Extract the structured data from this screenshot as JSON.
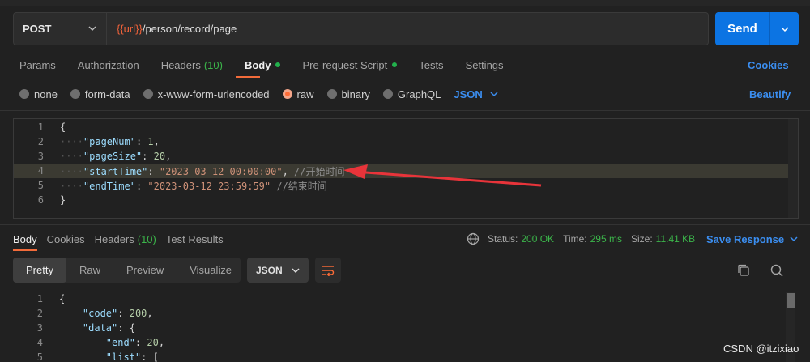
{
  "request": {
    "method": "POST",
    "url_var": "{{url}}",
    "url_path": "/person/record/page",
    "send_label": "Send"
  },
  "tabs": [
    {
      "label": "Params"
    },
    {
      "label": "Authorization"
    },
    {
      "label": "Headers",
      "count": "(10)"
    },
    {
      "label": "Body"
    },
    {
      "label": "Pre-request Script"
    },
    {
      "label": "Tests"
    },
    {
      "label": "Settings"
    }
  ],
  "cookies_label": "Cookies",
  "body_types": [
    "none",
    "form-data",
    "x-www-form-urlencoded",
    "raw",
    "binary",
    "GraphQL"
  ],
  "body_format": "JSON",
  "beautify_label": "Beautify",
  "request_body": {
    "line_numbers": [
      "1",
      "2",
      "3",
      "4",
      "5",
      "6"
    ],
    "l1": "{",
    "l2_key": "\"pageNum\"",
    "l2_val": "1",
    "l3_key": "\"pageSize\"",
    "l3_val": "20",
    "l4_key": "\"startTime\"",
    "l4_val": "\"2023-03-12 00:00:00\"",
    "l4_comment": "//开始时间",
    "l5_key": "\"endTime\"",
    "l5_val": "\"2023-03-12 23:59:59\"",
    "l5_comment": "//结束时间",
    "l6": "}"
  },
  "response": {
    "tabs": [
      {
        "label": "Body"
      },
      {
        "label": "Cookies"
      },
      {
        "label": "Headers",
        "count": "(10)"
      },
      {
        "label": "Test Results"
      }
    ],
    "status_label": "Status:",
    "status_value": "200 OK",
    "time_label": "Time:",
    "time_value": "295 ms",
    "size_label": "Size:",
    "size_value": "11.41 KB",
    "save_label": "Save Response",
    "views": [
      "Pretty",
      "Raw",
      "Preview",
      "Visualize"
    ],
    "format": "JSON",
    "line_numbers": [
      "1",
      "2",
      "3",
      "4",
      "5"
    ],
    "l1": "{",
    "l2_key": "\"code\"",
    "l2_val": "200",
    "l3_key": "\"data\"",
    "l3_rest": "{",
    "l4_key": "\"end\"",
    "l4_val": "20",
    "l5_key": "\"list\"",
    "l5_rest": "["
  },
  "watermark": "CSDN @itzixiao",
  "colors": {
    "accent_orange": "#ff6c37",
    "send_blue": "#0c74e3",
    "link_blue": "#3b8ef0",
    "green": "#3bb54a"
  }
}
